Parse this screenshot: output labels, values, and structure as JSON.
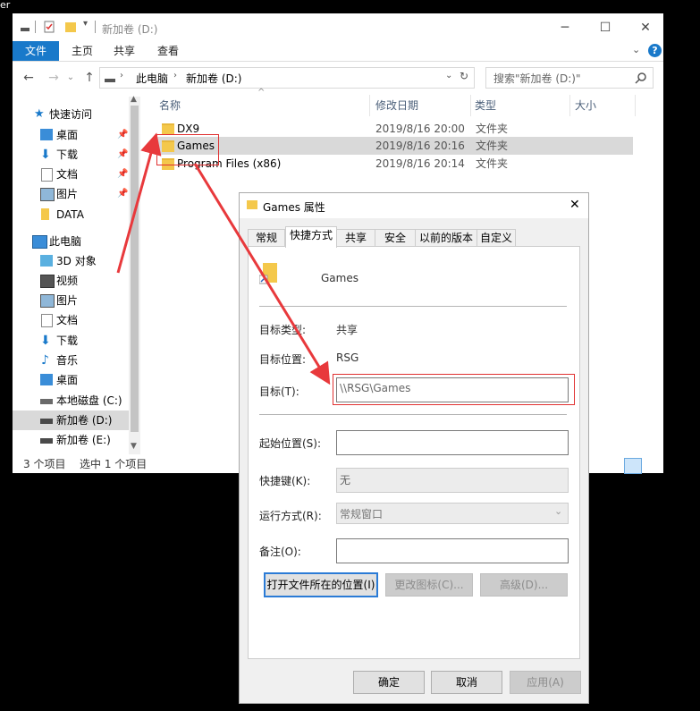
{
  "stray_text": "er",
  "explorer": {
    "title": "新加卷 (D:)",
    "ribbon_tabs": [
      "文件",
      "主页",
      "共享",
      "查看"
    ],
    "address": {
      "parts": [
        "此电脑",
        "新加卷 (D:)"
      ]
    },
    "search_placeholder": "搜索\"新加卷 (D:)\"",
    "sidebar": [
      {
        "label": "快速访问"
      },
      {
        "label": "桌面"
      },
      {
        "label": "下载"
      },
      {
        "label": "文档"
      },
      {
        "label": "图片"
      },
      {
        "label": "DATA"
      },
      {
        "label": "此电脑"
      },
      {
        "label": "3D 对象"
      },
      {
        "label": "视频"
      },
      {
        "label": "图片"
      },
      {
        "label": "文档"
      },
      {
        "label": "下载"
      },
      {
        "label": "音乐"
      },
      {
        "label": "桌面"
      },
      {
        "label": "本地磁盘 (C:)"
      },
      {
        "label": "新加卷 (D:)"
      },
      {
        "label": "新加卷 (E:)"
      }
    ],
    "columns": [
      "名称",
      "修改日期",
      "类型",
      "大小"
    ],
    "files": [
      {
        "name": "DX9",
        "date": "2019/8/16 20:00",
        "type": "文件夹"
      },
      {
        "name": "Games",
        "date": "2019/8/16 20:16",
        "type": "文件夹"
      },
      {
        "name": "Program Files (x86)",
        "date": "2019/8/16 20:14",
        "type": "文件夹"
      }
    ],
    "status": {
      "count": "3 个项目",
      "selected": "选中 1 个项目"
    }
  },
  "props": {
    "title": "Games 属性",
    "tabs": [
      "常规",
      "快捷方式",
      "共享",
      "安全",
      "以前的版本",
      "自定义"
    ],
    "name": "Games",
    "target_type_label": "目标类型:",
    "target_type_value": "共享",
    "target_location_label": "目标位置:",
    "target_location_value": "RSG",
    "target_label": "目标(T):",
    "target_value": "\\\\RSG\\Games",
    "start_label": "起始位置(S):",
    "start_value": "",
    "hotkey_label": "快捷键(K):",
    "hotkey_value": "无",
    "run_label": "运行方式(R):",
    "run_value": "常规窗口",
    "comment_label": "备注(O):",
    "comment_value": "",
    "btn_open_location": "打开文件所在的位置(I)",
    "btn_change_icon": "更改图标(C)...",
    "btn_advanced": "高级(D)...",
    "btn_ok": "确定",
    "btn_cancel": "取消",
    "btn_apply": "应用(A)"
  },
  "colors": {
    "accent": "#1979ca",
    "arrow": "#e8393c",
    "selection": "#d9d9d9"
  }
}
